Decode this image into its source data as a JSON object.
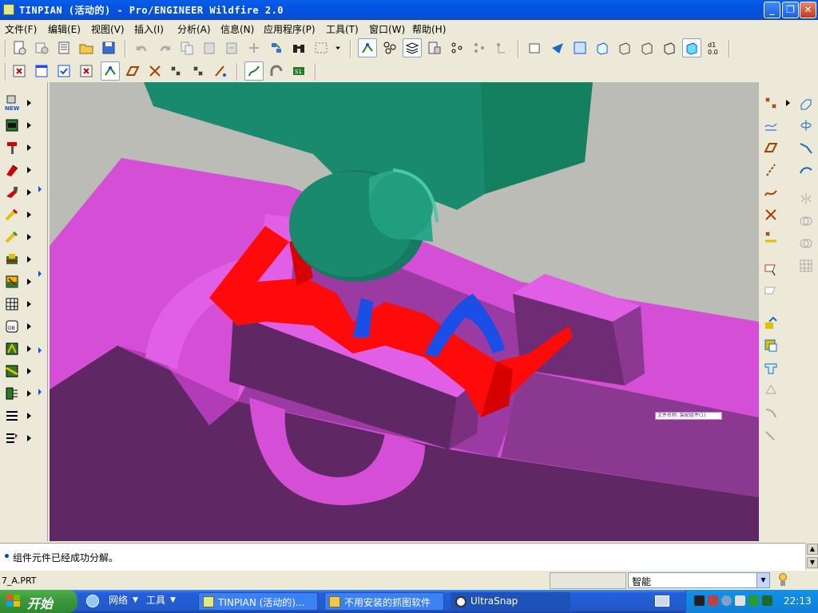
{
  "window": {
    "title": "TINPIAN (活动的) - Pro/ENGINEER Wildfire 2.0",
    "minimize_icon": "minimize-icon",
    "maximize_icon": "restore-icon",
    "close_icon": "close-icon"
  },
  "menu": {
    "items": [
      "文件(F)",
      "编辑(E)",
      "视图(V)",
      "插入(I)",
      "分析(A)",
      "信息(N)",
      "应用程序(P)",
      "工具(T)",
      "窗口(W)",
      "帮助(H)"
    ]
  },
  "viewport": {
    "tooltip_text": "文件名称: 装配组件(1)",
    "colors": {
      "background": "#bcbcb6",
      "mold_base": "#d44fd6",
      "mold_dark": "#5f2764",
      "fixture": "#1a8a6e",
      "part_red": "#ff0a0a",
      "part_blue": "#1a4ee6"
    }
  },
  "message": {
    "text": "组件元件已经成功分解。"
  },
  "status": {
    "filename": "7_A.PRT",
    "filter_value": "智能"
  },
  "taskbar": {
    "start_label": "开始",
    "quick_links": [
      "网络",
      "工具"
    ],
    "tasks": [
      "TINPIAN (活动的)...",
      "不用安装的抓图软件",
      "UltraSnap"
    ],
    "clock": "22:13"
  }
}
